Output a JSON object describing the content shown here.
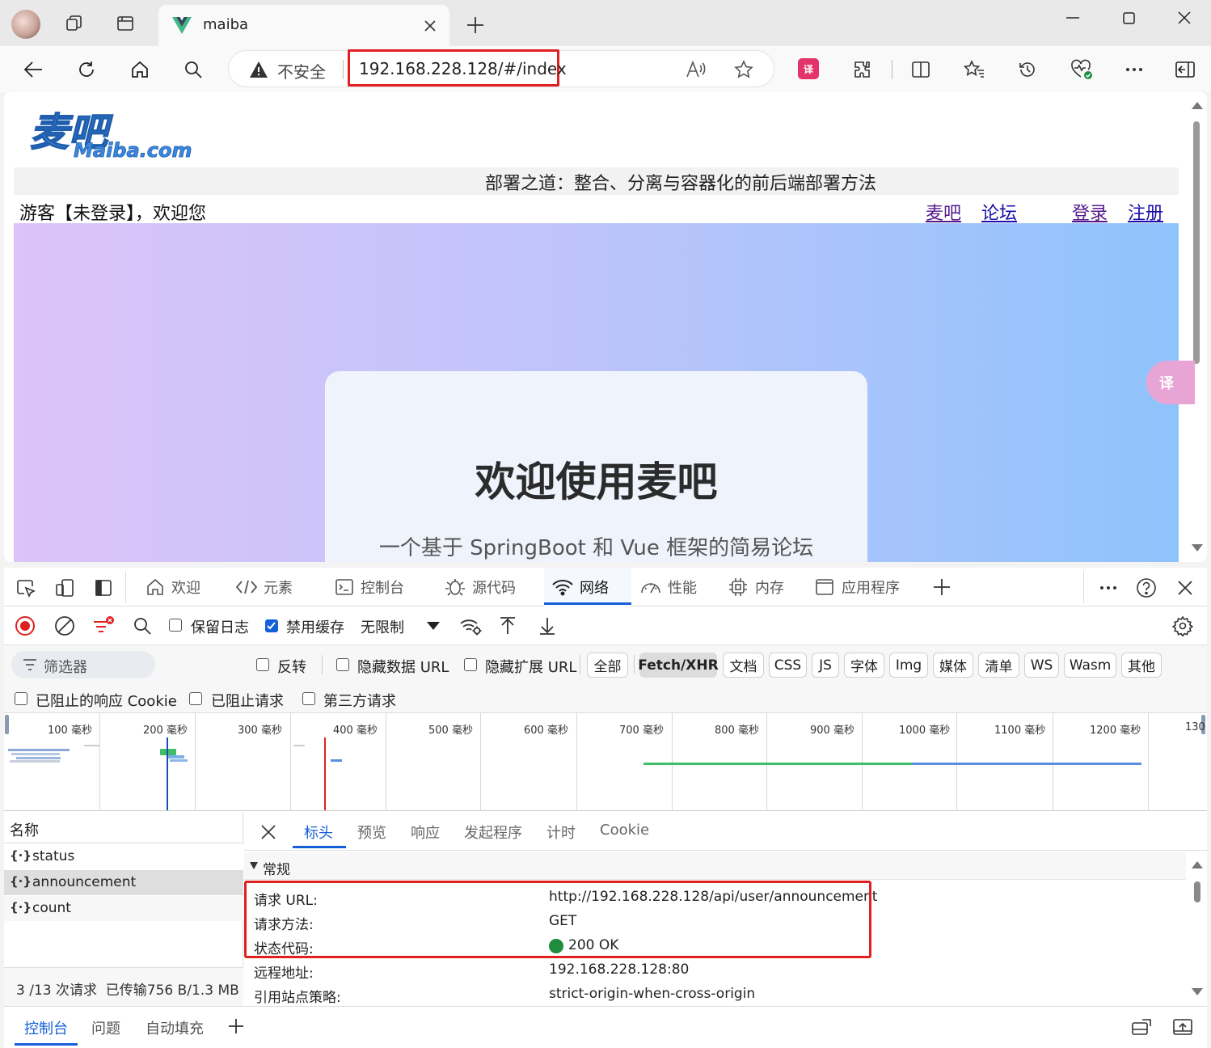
{
  "browser": {
    "tab_title": "maiba",
    "security_label": "不安全",
    "url": "192.168.228.128/#/index"
  },
  "page": {
    "banner_title": "部署之道：整合、分离与容器化的前后端部署方法",
    "greeting": "游客【未登录】，欢迎您",
    "nav_links": [
      "麦吧",
      "论坛",
      "登录",
      "注册"
    ],
    "welcome_title": "欢迎使用麦吧",
    "welcome_subtitle": "一个基于 SpringBoot 和 Vue 框架的简易论坛"
  },
  "devtools": {
    "tabs": [
      "欢迎",
      "元素",
      "控制台",
      "源代码",
      "网络",
      "性能",
      "内存",
      "应用程序"
    ],
    "active_tab": "网络",
    "toolbar": {
      "preserve_log": "保留日志",
      "disable_cache": "禁用缓存",
      "throttle": "无限制"
    },
    "filter": {
      "placeholder": "筛选器",
      "invert": "反转",
      "hide_data_urls": "隐藏数据 URL",
      "hide_ext_urls": "隐藏扩展 URL",
      "types": [
        "全部",
        "Fetch/XHR",
        "文档",
        "CSS",
        "JS",
        "字体",
        "Img",
        "媒体",
        "清单",
        "WS",
        "Wasm",
        "其他"
      ],
      "active_type": "Fetch/XHR",
      "blocked_cookies": "已阻止的响应 Cookie",
      "blocked_requests": "已阻止请求",
      "third_party": "第三方请求"
    },
    "timeline_ticks": [
      "100 毫秒",
      "200 毫秒",
      "300 毫秒",
      "400 毫秒",
      "500 毫秒",
      "600 毫秒",
      "700 毫秒",
      "800 毫秒",
      "900 毫秒",
      "1000 毫秒",
      "1100 毫秒",
      "1200 毫秒",
      "130"
    ],
    "requests": {
      "header": "名称",
      "items": [
        "status",
        "announcement",
        "count"
      ],
      "selected": "announcement",
      "summary": "3 /13 次请求  已传输756 B/1.3 MB"
    },
    "detail_tabs": [
      "标头",
      "预览",
      "响应",
      "发起程序",
      "计时",
      "Cookie"
    ],
    "active_detail_tab": "标头",
    "general": {
      "section_label": "常规",
      "rows": [
        {
          "label": "请求 URL:",
          "value": "http://192.168.228.128/api/user/announcement"
        },
        {
          "label": "请求方法:",
          "value": "GET"
        },
        {
          "label": "状态代码:",
          "value": "200 OK"
        },
        {
          "label": "远程地址:",
          "value": "192.168.228.128:80"
        },
        {
          "label": "引用站点策略:",
          "value": "strict-origin-when-cross-origin"
        }
      ]
    },
    "drawer_tabs": [
      "控制台",
      "问题",
      "自动填充"
    ],
    "active_drawer_tab": "控制台"
  },
  "colors": {
    "accent": "#1560d8",
    "highlight": "#e02020",
    "status_ok": "#1e8e3e"
  }
}
